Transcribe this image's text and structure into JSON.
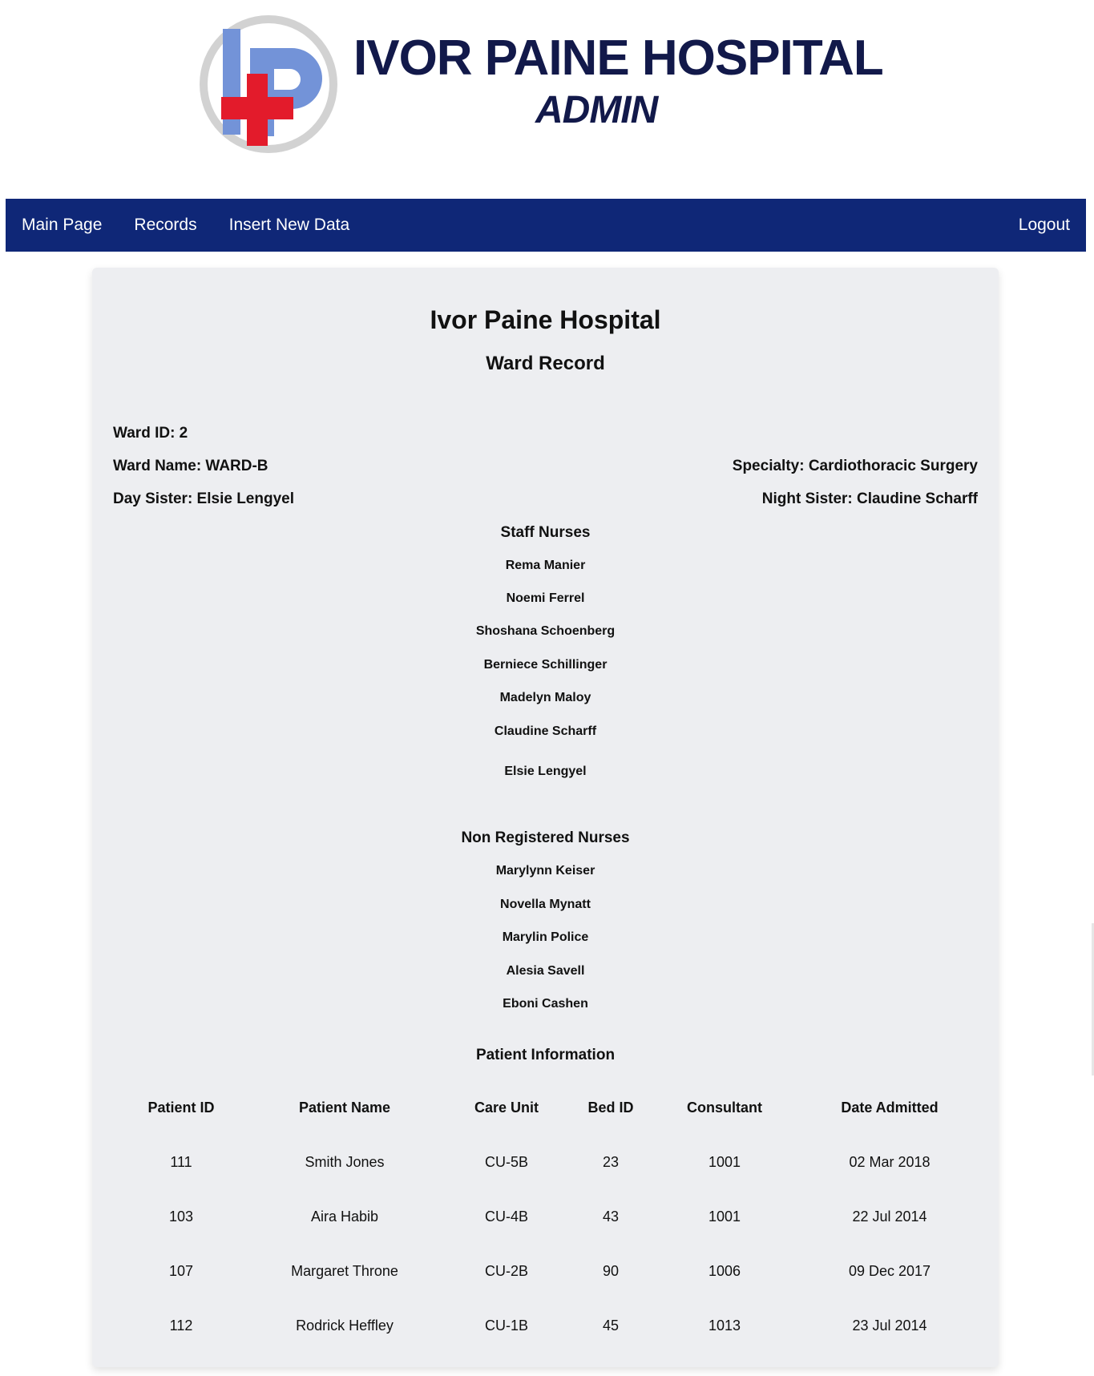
{
  "brand": {
    "title": "IVOR PAINE HOSPITAL",
    "subtitle": "ADMIN",
    "colors": {
      "navy": "#12194a",
      "blue": "#6f8fd6",
      "red": "#e01a2a",
      "ring": "#c9c9c9"
    },
    "emblem_icon": "hospital-logo-icon"
  },
  "nav": {
    "items": [
      {
        "label": "Main Page"
      },
      {
        "label": "Records"
      },
      {
        "label": "Insert New Data"
      }
    ],
    "logout_label": "Logout",
    "background": "#0f2777"
  },
  "record": {
    "hospital_name": "Ivor Paine Hospital",
    "heading": "Ward Record",
    "ward_id": "Ward ID: 2",
    "ward_name": "Ward Name: WARD-B",
    "specialty": "Specialty: Cardiothoracic Surgery",
    "day_sister": "Day Sister: Elsie Lengyel",
    "night_sister": "Night Sister: Claudine Scharff"
  },
  "staff_nurses": {
    "title": "Staff Nurses",
    "names": [
      "Rema Manier",
      "Noemi Ferrel",
      "Shoshana Schoenberg",
      "Berniece Schillinger",
      "Madelyn Maloy",
      "Claudine Scharff",
      "Elsie Lengyel"
    ]
  },
  "non_registered_nurses": {
    "title": "Non Registered Nurses",
    "names": [
      "Marylynn Keiser",
      "Novella Mynatt",
      "Marylin Police",
      "Alesia Savell",
      "Eboni Cashen"
    ]
  },
  "patients": {
    "title": "Patient Information",
    "headers": [
      "Patient ID",
      "Patient Name",
      "Care Unit",
      "Bed ID",
      "Consultant",
      "Date Admitted"
    ],
    "rows": [
      [
        "111",
        "Smith Jones",
        "CU-5B",
        "23",
        "1001",
        "02 Mar 2018"
      ],
      [
        "103",
        "Aira Habib",
        "CU-4B",
        "43",
        "1001",
        "22 Jul 2014"
      ],
      [
        "107",
        "Margaret Throne",
        "CU-2B",
        "90",
        "1006",
        "09 Dec 2017"
      ],
      [
        "112",
        "Rodrick Heffley",
        "CU-1B",
        "45",
        "1013",
        "23 Jul 2014"
      ]
    ]
  }
}
